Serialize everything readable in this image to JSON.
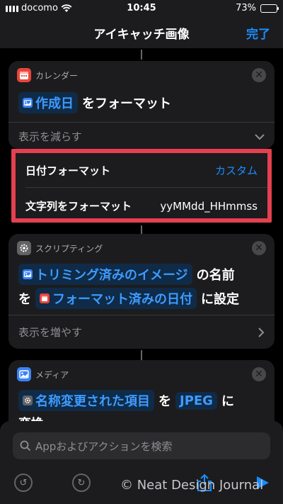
{
  "status": {
    "carrier": "docomo",
    "time": "10:45",
    "battery": "73%",
    "battery_level": 0.73
  },
  "nav": {
    "title": "アイキャッチ画像",
    "done_label": "完了"
  },
  "card1": {
    "category": "カレンダー",
    "token": "作成日",
    "action_text": "をフォーマット",
    "toggle_label": "表示を減らす"
  },
  "params": [
    {
      "label": "日付フォーマット",
      "value": "カスタム"
    },
    {
      "label": "文字列をフォーマット",
      "value": "yyMMdd_HHmmss"
    }
  ],
  "card2": {
    "category": "スクリプティング",
    "token1": "トリミング済みのイメージ",
    "text1": "の名前",
    "text2": "を",
    "token2": "フォーマット済みの日付",
    "text3": "に設定",
    "toggle_label": "表示を増やす"
  },
  "card3": {
    "category": "メディア",
    "token1": "名称変更された項目",
    "text1": "を",
    "token2": "JPEG",
    "text2": "に",
    "text3": "変換"
  },
  "bottom": {
    "search_placeholder": "Appおよびアクションを検索",
    "watermark": "© Neat Design Journal"
  },
  "colors": {
    "accent": "#1a8cff",
    "highlight": "#e5404f",
    "calendar": "#e8453c",
    "media": "#3b82f6"
  },
  "icons": [
    "wifi-icon",
    "calendar-icon",
    "gear-icon",
    "photo-icon",
    "search-icon",
    "undo-icon",
    "redo-icon",
    "share-icon",
    "play-icon"
  ]
}
